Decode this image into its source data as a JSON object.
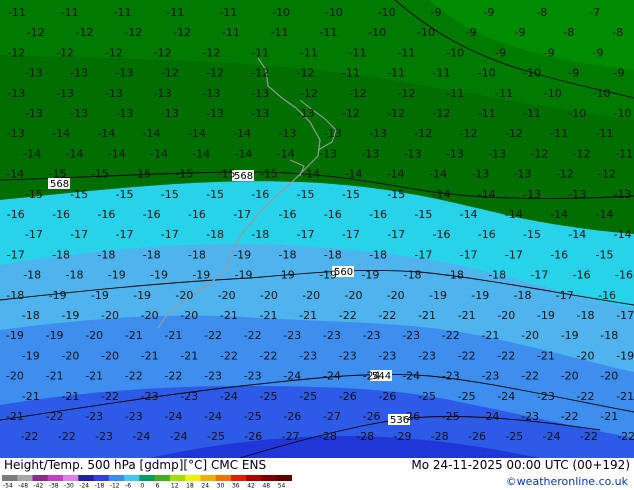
{
  "title": {
    "left": "Height/Temp. 500 hPa [gdmp][°C] CMC ENS",
    "right": "Mo 24-11-2025 00:00 UTC (00+192)"
  },
  "copyright": "©weatheronline.co.uk",
  "colorbar": {
    "labels": [
      "-54",
      "-48",
      "-42",
      "-38",
      "-30",
      "-24",
      "-18",
      "-12",
      "-6",
      "0",
      "6",
      "12",
      "18",
      "24",
      "30",
      "36",
      "42",
      "48",
      "54"
    ],
    "colors": [
      "#7a7a7a",
      "#a8a8a8",
      "#8b2c8b",
      "#c040c0",
      "#e080e0",
      "#2020a0",
      "#3040e0",
      "#3c8cf0",
      "#40c8f0",
      "#00a060",
      "#40b020",
      "#a0e000",
      "#f0f000",
      "#f0b000",
      "#f07000",
      "#e02000",
      "#b00000",
      "#800000",
      "#600000"
    ]
  },
  "map": {
    "band_colors": {
      "minus_11_to_8": "#008c00",
      "minus_14_to_11": "#007a00",
      "minus_17_to_14": "#28d2ea",
      "minus_20_to_17": "#4fb4ee",
      "minus_23_to_20": "#3e8ef0",
      "minus_26_to_23": "#2e5ae8",
      "minus_29_to_26": "#2036d6"
    },
    "iso_labels": [
      "568",
      "568",
      "560",
      "544",
      "536"
    ],
    "values": [
      "-11",
      "-11",
      "-11",
      "-11",
      "-11",
      "-10",
      "-10",
      "-10",
      "-9",
      "-9",
      "-8",
      "-7",
      "-12",
      "-12",
      "-12",
      "-12",
      "-11",
      "-11",
      "-11",
      "-10",
      "-10",
      "-9",
      "-9",
      "-8",
      "-8",
      "-12",
      "-12",
      "-12",
      "-12",
      "-12",
      "-11",
      "-11",
      "-11",
      "-11",
      "-10",
      "-9",
      "-9",
      "-9",
      "-13",
      "-13",
      "-13",
      "-12",
      "-12",
      "-12",
      "-12",
      "-11",
      "-11",
      "-11",
      "-10",
      "-10",
      "-9",
      "-9",
      "-13",
      "-13",
      "-13",
      "-13",
      "-13",
      "-13",
      "-12",
      "-12",
      "-12",
      "-11",
      "-11",
      "-10",
      "-10",
      "-13",
      "-13",
      "-13",
      "-13",
      "-13",
      "-13",
      "-13",
      "-12",
      "-12",
      "-12",
      "-11",
      "-11",
      "-10",
      "-10",
      "-13",
      "-14",
      "-14",
      "-14",
      "-14",
      "-14",
      "-13",
      "-13",
      "-13",
      "-12",
      "-12",
      "-12",
      "-11",
      "-11",
      "-14",
      "-14",
      "-14",
      "-14",
      "-14",
      "-14",
      "-14",
      "-13",
      "-13",
      "-13",
      "-13",
      "-13",
      "-12",
      "-12",
      "-11",
      "-14",
      "-15",
      "-15",
      "-15",
      "-15",
      "-15",
      "-15",
      "-14",
      "-14",
      "-14",
      "-14",
      "-13",
      "-13",
      "-12",
      "-12",
      "-15",
      "-15",
      "-15",
      "-15",
      "-15",
      "-16",
      "-15",
      "-15",
      "-15",
      "-14",
      "-14",
      "-13",
      "-13",
      "-13",
      "-16",
      "-16",
      "-16",
      "-16",
      "-16",
      "-17",
      "-16",
      "-16",
      "-16",
      "-15",
      "-14",
      "-14",
      "-14",
      "-14",
      "-17",
      "-17",
      "-17",
      "-17",
      "-18",
      "-18",
      "-17",
      "-17",
      "-17",
      "-16",
      "-16",
      "-15",
      "-14",
      "-14",
      "-17",
      "-18",
      "-18",
      "-18",
      "-18",
      "-19",
      "-18",
      "-18",
      "-18",
      "-17",
      "-17",
      "-17",
      "-16",
      "-15",
      "-18",
      "-18",
      "-19",
      "-19",
      "-19",
      "-19",
      "-19",
      "-19",
      "-19",
      "-18",
      "-18",
      "-18",
      "-17",
      "-16",
      "-16",
      "-18",
      "-19",
      "-19",
      "-19",
      "-20",
      "-20",
      "-20",
      "-20",
      "-20",
      "-20",
      "-19",
      "-19",
      "-18",
      "-17",
      "-16",
      "-18",
      "-19",
      "-20",
      "-20",
      "-20",
      "-21",
      "-21",
      "-21",
      "-22",
      "-22",
      "-21",
      "-21",
      "-20",
      "-19",
      "-18",
      "-17",
      "-19",
      "-19",
      "-20",
      "-21",
      "-21",
      "-22",
      "-22",
      "-23",
      "-23",
      "-23",
      "-23",
      "-22",
      "-21",
      "-20",
      "-19",
      "-18",
      "-19",
      "-20",
      "-20",
      "-21",
      "-21",
      "-22",
      "-22",
      "-23",
      "-23",
      "-23",
      "-23",
      "-22",
      "-22",
      "-21",
      "-20",
      "-19",
      "-20",
      "-21",
      "-21",
      "-22",
      "-22",
      "-23",
      "-23",
      "-24",
      "-24",
      "-24",
      "-24",
      "-23",
      "-23",
      "-22",
      "-20",
      "-20",
      "-21",
      "-21",
      "-22",
      "-23",
      "-23",
      "-24",
      "-25",
      "-25",
      "-26",
      "-26",
      "-25",
      "-25",
      "-24",
      "-23",
      "-22",
      "-21",
      "-21",
      "-22",
      "-23",
      "-23",
      "-24",
      "-24",
      "-25",
      "-26",
      "-27",
      "-26",
      "-26",
      "-25",
      "-24",
      "-23",
      "-22",
      "-21",
      "-22",
      "-22",
      "-23",
      "-24",
      "-24",
      "-25",
      "-26",
      "-27",
      "-28",
      "-28",
      "-29",
      "-28",
      "-26",
      "-25",
      "-24",
      "-22",
      "-22"
    ]
  }
}
